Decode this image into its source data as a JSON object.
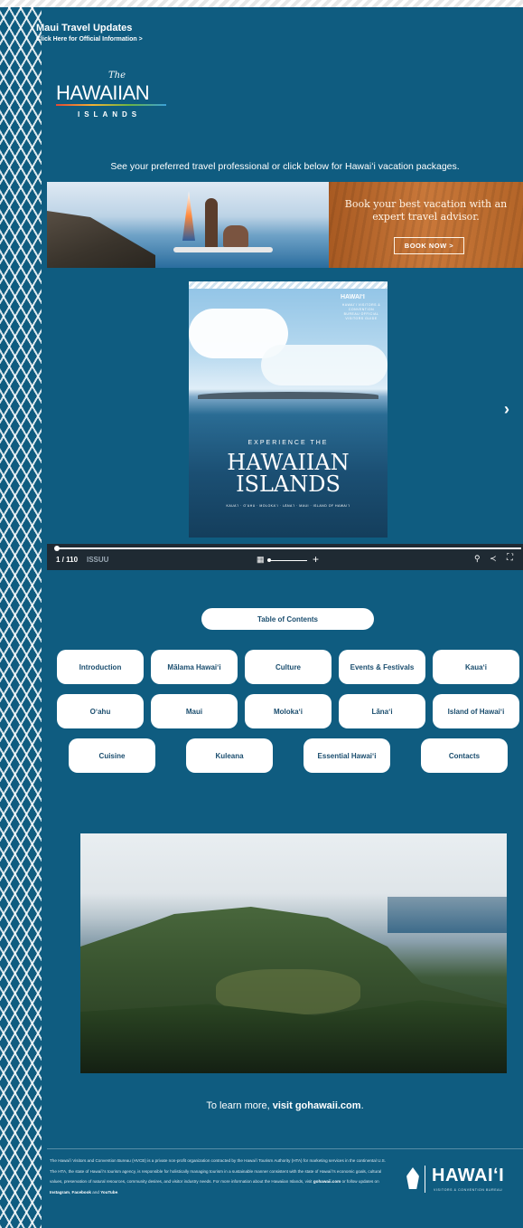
{
  "header": {
    "title": "Maui Travel Updates",
    "subtitle": "Click Here for Official Information >"
  },
  "logo": {
    "the": "The",
    "main": "HAWAIIAN",
    "sub": "ISLANDS"
  },
  "tagline": "See your preferred travel professional or click below for Hawaiʻi vacation packages.",
  "banner": {
    "text": "Book your best vacation with an expert travel advisor.",
    "button": "BOOK NOW >"
  },
  "magazine": {
    "brand": "HAWAIʻI",
    "side_text": "HAWAIʻI VISITORS & CONVENTION BUREAU OFFICIAL VISITORS GUIDE",
    "experience": "EXPERIENCE THE",
    "title_line1": "HAWAIIAN",
    "title_line2": "ISLANDS",
    "islands_list": "KAUAʻI · OʻAHU · MOLOKAʻI · LĀNAʻI · MAUI · ISLAND OF HAWAIʻI"
  },
  "viewer": {
    "page": "1 / 110",
    "brand": "ISSUU",
    "plus": "+",
    "grid_icon": "grid-icon",
    "next_icon": "chevron-right-icon"
  },
  "nav": {
    "toc": "Table of Contents",
    "row1": [
      "Introduction",
      "Mālama Hawaiʻi",
      "Culture",
      "Events & Festivals",
      "Kauaʻi"
    ],
    "row2": [
      "Oʻahu",
      "Maui",
      "Molokaʻi",
      "Lānaʻi",
      "Island of Hawaiʻi"
    ],
    "row3": [
      "Cuisine",
      "Kuleana",
      "Essential Hawaiʻi",
      "Contacts"
    ]
  },
  "learn": {
    "prefix": "To learn more, ",
    "link": "visit gohawaii.com",
    "suffix": "."
  },
  "footer": {
    "text_a": "The Hawaiʻi Visitors and Convention Bureau (HVCB) is a private non-profit organization contracted by the Hawaiʻi Tourism Authority (HTA) for marketing services in the continental U.S. The HTA, the state of Hawaiʻi's tourism agency, is responsible for holistically managing tourism in a sustainable manner consistent with the state of Hawaiʻi's economic goals, cultural values, preservation of natural resources, community desires, and visitor industry needs. For more information about the Hawaiian Islands, visit ",
    "link1": "gohawaii.com",
    "text_b": " or follow updates on ",
    "link2": "Instagram",
    "text_c": ", ",
    "link3": "Facebook",
    "text_d": " and ",
    "link4": "YouTube",
    "text_e": ".",
    "logo_text": "HAWAIʻI",
    "logo_sub": "VISITORS & CONVENTION BUREAU"
  }
}
